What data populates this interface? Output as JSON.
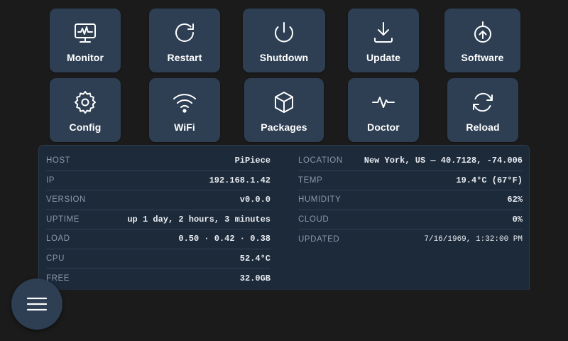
{
  "buttons_row1": [
    {
      "label": "Monitor",
      "icon": "monitor-icon"
    },
    {
      "label": "Restart",
      "icon": "restart-icon"
    },
    {
      "label": "Shutdown",
      "icon": "power-icon"
    },
    {
      "label": "Update",
      "icon": "download-icon"
    },
    {
      "label": "Software",
      "icon": "software-icon"
    }
  ],
  "buttons_row2": [
    {
      "label": "Config",
      "icon": "gear-icon"
    },
    {
      "label": "WiFi",
      "icon": "wifi-icon"
    },
    {
      "label": "Packages",
      "icon": "package-icon"
    },
    {
      "label": "Doctor",
      "icon": "pulse-icon"
    },
    {
      "label": "Reload",
      "icon": "reload-icon"
    }
  ],
  "info": {
    "left": [
      {
        "key": "HOST",
        "value": "PiPiece"
      },
      {
        "key": "IP",
        "value": "192.168.1.42"
      },
      {
        "key": "VERSION",
        "value": "v0.0.0"
      },
      {
        "key": "UPTIME",
        "value": "up 1 day, 2 hours, 3 minutes"
      },
      {
        "key": "LOAD",
        "value": "0.50 · 0.42 · 0.38"
      },
      {
        "key": "CPU",
        "value": "52.4°C"
      },
      {
        "key": "FREE",
        "value": "32.0GB"
      }
    ],
    "right": [
      {
        "key": "LOCATION",
        "value": "New York, US — 40.7128, -74.006"
      },
      {
        "key": "TEMP",
        "value": "19.4°C (67°F)"
      },
      {
        "key": "HUMIDITY",
        "value": "62%"
      },
      {
        "key": "CLOUD",
        "value": "0%"
      },
      {
        "key": "UPDATED",
        "value": "7/16/1969, 1:32:00 PM"
      }
    ]
  },
  "menu": {
    "icon": "hamburger-menu-icon"
  },
  "colors": {
    "background": "#1b1b1b",
    "tile": "#2e3f54",
    "panel": "#1d2a3a",
    "label_key": "#8a98aa",
    "value": "#e8ecf1"
  }
}
